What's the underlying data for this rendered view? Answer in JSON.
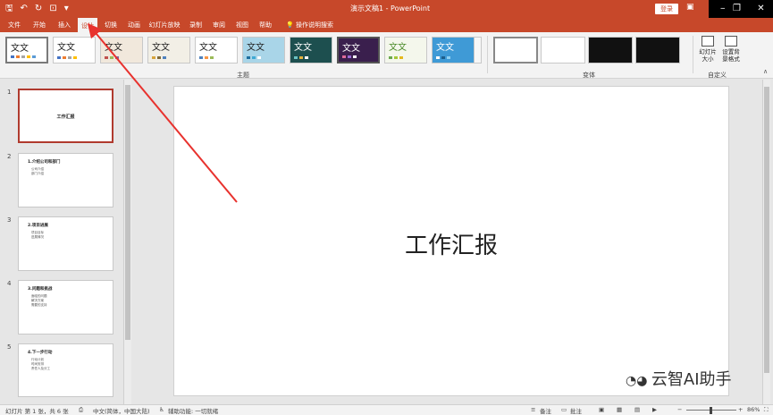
{
  "titlebar": {
    "title": "演示文稿1 - PowerPoint",
    "login": "登录",
    "qat": [
      "save-icon",
      "undo-icon",
      "redo-icon",
      "start-icon",
      "customize-icon"
    ]
  },
  "tabs": {
    "items": [
      {
        "label": "文件"
      },
      {
        "label": "开始"
      },
      {
        "label": "插入"
      },
      {
        "label": "设计"
      },
      {
        "label": "切换"
      },
      {
        "label": "动画"
      },
      {
        "label": "幻灯片放映"
      },
      {
        "label": "录制"
      },
      {
        "label": "审阅"
      },
      {
        "label": "视图"
      },
      {
        "label": "帮助"
      }
    ],
    "tell_me": "操作说明搜索"
  },
  "ribbon": {
    "theme_sample": "文文",
    "theme_group_label": "主题",
    "variant_group_label": "变体",
    "custom_group_label": "自定义",
    "slide_size_label": "幻灯片\n大小",
    "format_bg_label": "设置背\n景格式"
  },
  "thumbnails": [
    {
      "num": "1",
      "title": "工作汇报",
      "heading": "",
      "bullets": []
    },
    {
      "num": "2",
      "title": "",
      "heading": "1.介绍公司和部门",
      "bullets": [
        "公司介绍",
        "部门介绍"
      ]
    },
    {
      "num": "3",
      "title": "",
      "heading": "2.项目进展",
      "bullets": [
        "项目目标",
        "进展情况"
      ]
    },
    {
      "num": "4",
      "title": "",
      "heading": "3.问题和挑战",
      "bullets": [
        "面临的问题",
        "解决方案",
        "需要的支持"
      ]
    },
    {
      "num": "5",
      "title": "",
      "heading": "4.下一步行动",
      "bullets": [
        "行动计划",
        "时间安排",
        "责任人及分工"
      ]
    }
  ],
  "slide": {
    "title": "工作汇报"
  },
  "status": {
    "slide_info": "幻灯片 第 1 张，共 6 张",
    "language": "中文(简体，中国大陆)",
    "accessibility": "辅助功能: 一切就绪",
    "notes": "备注",
    "comments": "批注",
    "zoom": "86%"
  },
  "watermark": "云智AI助手",
  "colors": {
    "accent": "#c7482a"
  }
}
